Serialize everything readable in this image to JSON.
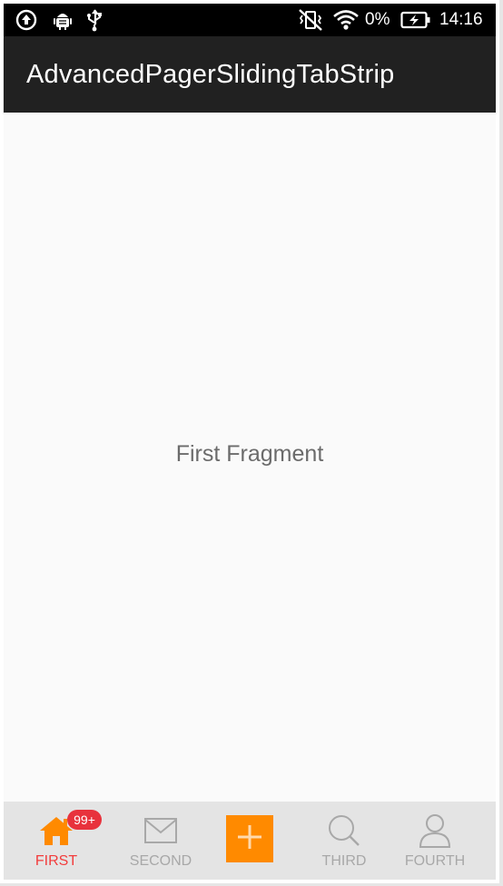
{
  "status_bar": {
    "icons_left": [
      "upload-icon",
      "android-debug-icon",
      "usb-icon"
    ],
    "icons_right": [
      "vibrate-off-icon",
      "wifi-icon"
    ],
    "battery_percent": "0%",
    "battery_icon": "battery-charging-icon",
    "time": "14:16"
  },
  "app_bar": {
    "title": "AdvancedPagerSlidingTabStrip"
  },
  "content": {
    "fragment_text": "First Fragment"
  },
  "tabs": {
    "items": [
      {
        "label": "FIRST",
        "icon": "home-icon",
        "active": true,
        "badge": "99+"
      },
      {
        "label": "SECOND",
        "icon": "mail-icon",
        "active": false
      },
      {
        "label": "THIRD",
        "icon": "search-icon",
        "active": false
      },
      {
        "label": "FOURTH",
        "icon": "person-icon",
        "active": false
      }
    ],
    "center_button": {
      "icon": "plus-icon"
    }
  },
  "colors": {
    "accent": "#ff8a00",
    "active_tab_label": "#f23c3c",
    "badge": "#e8323c",
    "app_bar": "#212121",
    "status_bar": "#000000",
    "inactive_tab": "#a8a8a8"
  }
}
